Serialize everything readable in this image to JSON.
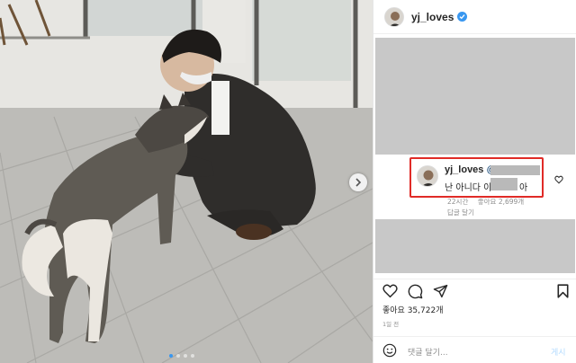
{
  "post": {
    "username": "yj_loves",
    "verified": true,
    "carousel": {
      "count": 4,
      "active": 1
    }
  },
  "comment": {
    "username": "yj_loves",
    "mention": "@",
    "text_prefix": "난 아니다 이",
    "text_suffix": "아",
    "time": "22시간",
    "likes": "좋아요 2,699개",
    "reply": "답글 달기"
  },
  "actions": {
    "like_icon": "heart-icon",
    "comment_icon": "comment-icon",
    "share_icon": "share-icon",
    "save_icon": "bookmark-icon"
  },
  "likes_total": "좋아요 35,722개",
  "posted_ago": "1일 전",
  "add_comment": {
    "placeholder": "댓글 달기...",
    "post_label": "게시"
  },
  "colors": {
    "highlight": "#e02b27",
    "link": "#3897f0",
    "muted": "#8e8e8e"
  }
}
